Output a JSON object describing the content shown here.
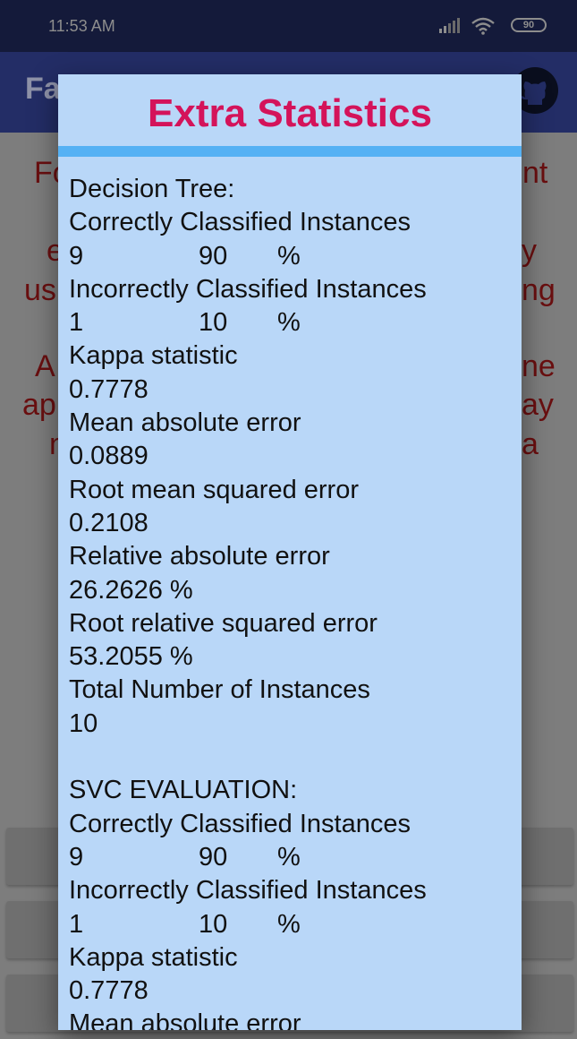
{
  "status_bar": {
    "time": "11:53 AM",
    "battery": "90",
    "icons": [
      "signal-icon",
      "wifi-icon",
      "battery-icon"
    ]
  },
  "app_bar": {
    "title_fragment": "Fa",
    "icon": "github-icon"
  },
  "background_text": {
    "lines": [
      {
        "left": "Fo",
        "right": "nt"
      },
      {
        "left": "e",
        "right": "y"
      },
      {
        "left": "us",
        "right": "ng"
      },
      {
        "left": "A",
        "right": "ne"
      },
      {
        "left": "ap",
        "right": "ay"
      },
      {
        "left": "n",
        "right": "a"
      }
    ]
  },
  "dialog": {
    "title": "Extra Statistics",
    "decision_tree": {
      "heading": "Decision Tree:",
      "correct_label": "Correctly Classified Instances",
      "correct_count": "9",
      "correct_pct": "90",
      "correct_unit": "%",
      "incorrect_label": "Incorrectly Classified Instances",
      "incorrect_count": "1",
      "incorrect_pct": "10",
      "incorrect_unit": "%",
      "kappa_label": "Kappa statistic",
      "kappa_value": "0.7778",
      "mae_label": "Mean absolute error",
      "mae_value": "0.0889",
      "rmse_label": "Root mean squared error",
      "rmse_value": "0.2108",
      "rae_label": "Relative absolute error",
      "rae_value": "26.2626 %",
      "rrse_label": "Root relative squared error",
      "rrse_value": "53.2055 %",
      "total_label": "Total Number of Instances",
      "total_value": "10"
    },
    "svc": {
      "heading": "SVC EVALUATION:",
      "correct_label": "Correctly Classified Instances",
      "correct_count": "9",
      "correct_pct": "90",
      "correct_unit": "%",
      "incorrect_label": "Incorrectly Classified Instances",
      "incorrect_count": "1",
      "incorrect_pct": "10",
      "incorrect_unit": "%",
      "kappa_label": "Kappa statistic",
      "kappa_value": "0.7778",
      "mae_label": "Mean absolute error"
    }
  },
  "colors": {
    "dialog_bg": "#b9d7f8",
    "title": "#d4135a",
    "divider": "#55b1f4"
  }
}
